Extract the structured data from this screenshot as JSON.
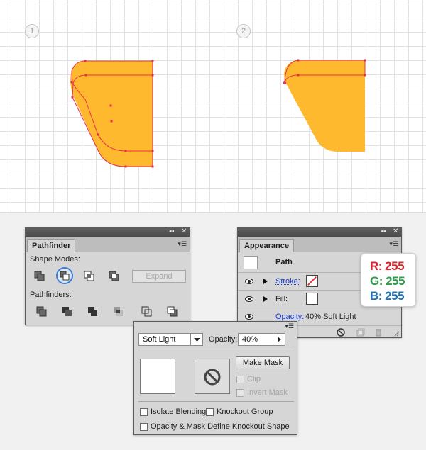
{
  "canvas": {
    "steps": [
      "1",
      "2"
    ],
    "shape_color": "#ffb92e",
    "anchor_color": "#e8304a"
  },
  "pathfinder": {
    "tab": "Pathfinder",
    "shape_modes_label": "Shape Modes:",
    "expand_label": "Expand",
    "pathfinders_label": "Pathfinders:",
    "collapse_glyph": "◂◂",
    "close_glyph": "✕",
    "menu_glyph": "▾☰"
  },
  "appearance": {
    "tab": "Appearance",
    "path_label": "Path",
    "stroke_label": "Stroke:",
    "fill_label": "Fill:",
    "opacity_label": "Opacity:",
    "opacity_value": "40% Soft Light",
    "collapse_glyph": "◂◂",
    "close_glyph": "✕",
    "menu_glyph": "▾☰"
  },
  "rgb": {
    "r": "R: 255",
    "g": "G: 255",
    "b": "B: 255",
    "r_color": "#d8262e",
    "g_color": "#2e9a4a",
    "b_color": "#1f73b8"
  },
  "transparency": {
    "blend_mode": "Soft Light",
    "opacity_label": "Opacity:",
    "opacity_value": "40%",
    "make_mask": "Make Mask",
    "clip": "Clip",
    "invert_mask": "Invert Mask",
    "isolate_blending": "Isolate Blending",
    "knockout_group": "Knockout Group",
    "opacity_mask_knockout": "Opacity & Mask Define Knockout Shape",
    "menu_glyph": "▾☰"
  }
}
